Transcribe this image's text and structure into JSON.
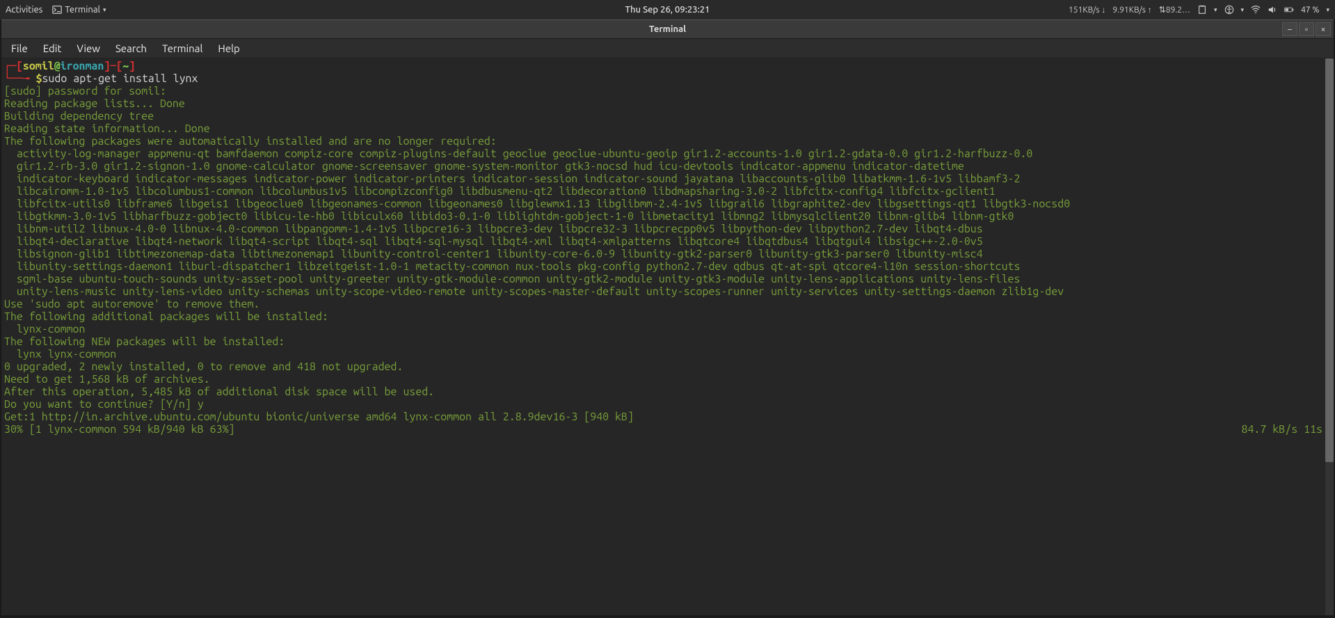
{
  "topbar": {
    "activities": "Activities",
    "app_name": "Terminal",
    "clock": "Thu Sep 26, 09:23:21",
    "net_down": "151KB/s",
    "net_up": "9.91KB/s",
    "net_other": "⇅89.2…",
    "battery": "47 %"
  },
  "window": {
    "title": "Terminal",
    "menus": [
      "File",
      "Edit",
      "View",
      "Search",
      "Terminal",
      "Help"
    ]
  },
  "prompt": {
    "bracket_l": "┌─[",
    "user": "somil",
    "at": "@",
    "host": "ironman",
    "bracket_m": "]─[",
    "path": "~",
    "bracket_r": "]",
    "line2_prefix": "└──╼ ",
    "dollar": "$",
    "command": "sudo apt-get install lynx"
  },
  "out": {
    "sudo_pw": "[sudo] password for somil:",
    "reading_lists": "Reading package lists... Done",
    "building_tree": "Building dependency tree",
    "reading_state": "Reading state information... Done",
    "auto_hdr": "The following packages were automatically installed and are no longer required:",
    "pkgs": [
      "activity-log-manager appmenu-qt bamfdaemon compiz-core compiz-plugins-default geoclue geoclue-ubuntu-geoip gir1.2-accounts-1.0 gir1.2-gdata-0.0 gir1.2-harfbuzz-0.0",
      "gir1.2-rb-3.0 gir1.2-signon-1.0 gnome-calculator gnome-screensaver gnome-system-monitor gtk3-nocsd hud icu-devtools indicator-appmenu indicator-datetime",
      "indicator-keyboard indicator-messages indicator-power indicator-printers indicator-session indicator-sound jayatana libaccounts-glib0 libatkmm-1.6-1v5 libbamf3-2",
      "libcairomm-1.0-1v5 libcolumbus1-common libcolumbus1v5 libcompizconfig0 libdbusmenu-qt2 libdecoration0 libdmapsharing-3.0-2 libfcitx-config4 libfcitx-gclient1",
      "libfcitx-utils0 libframe6 libgeis1 libgeoclue0 libgeonames-common libgeonames0 libglewmx1.13 libglibmm-2.4-1v5 libgrail6 libgraphite2-dev libgsettings-qt1 libgtk3-nocsd0",
      "libgtkmm-3.0-1v5 libharfbuzz-gobject0 libicu-le-hb0 libiculx60 libido3-0.1-0 liblightdm-gobject-1-0 libmetacity1 libmng2 libmysqlclient20 libnm-glib4 libnm-gtk0",
      "libnm-util2 libnux-4.0-0 libnux-4.0-common libpangomm-1.4-1v5 libpcre16-3 libpcre3-dev libpcre32-3 libpcrecpp0v5 libpython-dev libpython2.7-dev libqt4-dbus",
      "libqt4-declarative libqt4-network libqt4-script libqt4-sql libqt4-sql-mysql libqt4-xml libqt4-xmlpatterns libqtcore4 libqtdbus4 libqtgui4 libsigc++-2.0-0v5",
      "libsignon-glib1 libtimezonemap-data libtimezonemap1 libunity-control-center1 libunity-core-6.0-9 libunity-gtk2-parser0 libunity-gtk3-parser0 libunity-misc4",
      "libunity-settings-daemon1 liburl-dispatcher1 libzeitgeist-1.0-1 metacity-common nux-tools pkg-config python2.7-dev qdbus qt-at-spi qtcore4-l10n session-shortcuts",
      "sgml-base ubuntu-touch-sounds unity-asset-pool unity-greeter unity-gtk-module-common unity-gtk2-module unity-gtk3-module unity-lens-applications unity-lens-files",
      "unity-lens-music unity-lens-video unity-schemas unity-scope-video-remote unity-scopes-master-default unity-scopes-runner unity-services unity-settings-daemon zlib1g-dev"
    ],
    "autoremove": "Use 'sudo apt autoremove' to remove them.",
    "additional_hdr": "The following additional packages will be installed:",
    "additional_pkgs": "lynx-common",
    "new_hdr": "The following NEW packages will be installed:",
    "new_pkgs": "lynx lynx-common",
    "summary": "0 upgraded, 2 newly installed, 0 to remove and 418 not upgraded.",
    "need_get": "Need to get 1,568 kB of archives.",
    "after_op": "After this operation, 5,485 kB of additional disk space will be used.",
    "continue_prompt": "Do you want to continue? [Y/n] y",
    "get1": "Get:1 http://in.archive.ubuntu.com/ubuntu bionic/universe amd64 lynx-common all 2.8.9dev16-3 [940 kB]",
    "progress_left": "30% [1 lynx-common 594 kB/940 kB 63%]",
    "progress_right": "84.7 kB/s 11s"
  }
}
